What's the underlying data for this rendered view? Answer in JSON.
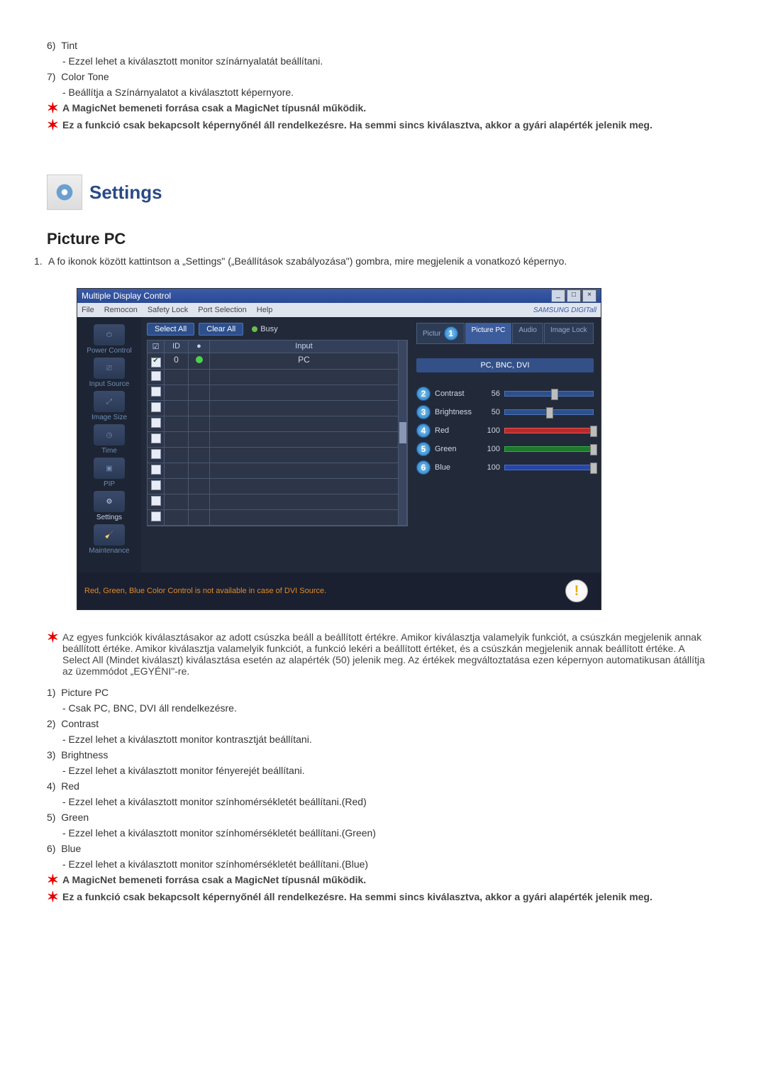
{
  "top": {
    "n6": "6)",
    "t6": "Tint",
    "d6": "- Ezzel lehet a kiválasztott monitor színárnyalatát beállítani.",
    "n7": "7)",
    "t7": "Color Tone",
    "d7": "- Beállítja a Színárnyalatot a kiválasztott képernyore.",
    "star1": "A MagicNet bemeneti forrása csak a MagicNet típusnál működik.",
    "star2": "Ez a funkció csak bekapcsolt képernyőnél áll rendelkezésre. Ha semmi sincs kiválasztva, akkor a gyári alapérték jelenik meg."
  },
  "section": {
    "title": "Settings"
  },
  "setting_name": "Picture PC",
  "ol1": {
    "n": "1.",
    "txt": "A fo ikonok között kattintson a „Settings\" („Beállítások szabályozása\") gombra, mire megjelenik a vonatkozó képernyo."
  },
  "app": {
    "title": "Multiple Display Control",
    "menu": [
      "File",
      "Remocon",
      "Safety Lock",
      "Port Selection",
      "Help"
    ],
    "brand": "SAMSUNG DIGITall",
    "select_all": "Select All",
    "clear_all": "Clear All",
    "busy": "Busy",
    "side": [
      "Power Control",
      "Input Source",
      "Image Size",
      "Time",
      "PIP",
      "Settings",
      "Maintenance"
    ],
    "grid_headers": {
      "id": "ID",
      "input": "Input"
    },
    "grid_id": "0",
    "grid_input": "PC",
    "tabs": [
      "Pictur",
      "Picture PC",
      "Audio",
      "Image Lock"
    ],
    "source": "PC, BNC, DVI",
    "sliders": [
      {
        "label": "Contrast",
        "value": "56",
        "badge": "2",
        "cls": ""
      },
      {
        "label": "Brightness",
        "value": "50",
        "badge": "3",
        "cls": ""
      },
      {
        "label": "Red",
        "value": "100",
        "badge": "4",
        "cls": "red"
      },
      {
        "label": "Green",
        "value": "100",
        "badge": "5",
        "cls": "green"
      },
      {
        "label": "Blue",
        "value": "100",
        "badge": "6",
        "cls": "blue"
      }
    ],
    "tab_badge": "1",
    "footer": "Red, Green, Blue Color Control is not available in case of DVI Source."
  },
  "mid_star": "Az egyes funkciók kiválasztásakor az adott csúszka beáll a beállított értékre. Amikor kiválasztja valamelyik funkciót, a csúszkán megjelenik annak beállított értéke. Amikor kiválasztja valamelyik funkciót, a funkció lekéri a beállított értéket, és a csúszkán megjelenik annak beállított értéke. A Select All (Mindet kiválaszt) kiválasztása esetén az alapérték (50) jelenik meg. Az értékek megváltoztatása ezen képernyon automatikusan átállítja az üzemmódot „EGYÉNI\"-re.",
  "list": {
    "n1": "1)",
    "t1": "Picture PC",
    "d1": "- Csak PC, BNC, DVI áll rendelkezésre.",
    "n2": "2)",
    "t2": "Contrast",
    "d2": "- Ezzel lehet a kiválasztott monitor kontrasztját beállítani.",
    "n3": "3)",
    "t3": "Brightness",
    "d3": "- Ezzel lehet a kiválasztott monitor fényerejét beállítani.",
    "n4": "4)",
    "t4": "Red",
    "d4": "- Ezzel lehet a kiválasztott monitor színhomérsékletét beállítani.(Red)",
    "n5": "5)",
    "t5": "Green",
    "d5": "- Ezzel lehet a kiválasztott monitor színhomérsékletét beállítani.(Green)",
    "n6": "6)",
    "t6": "Blue",
    "d6": "- Ezzel lehet a kiválasztott monitor színhomérsékletét beállítani.(Blue)"
  },
  "bottom": {
    "star1": "A MagicNet bemeneti forrása csak a MagicNet típusnál működik.",
    "star2": "Ez a funkció csak bekapcsolt képernyőnél áll rendelkezésre. Ha semmi sincs kiválasztva, akkor a gyári alapérték jelenik meg."
  }
}
